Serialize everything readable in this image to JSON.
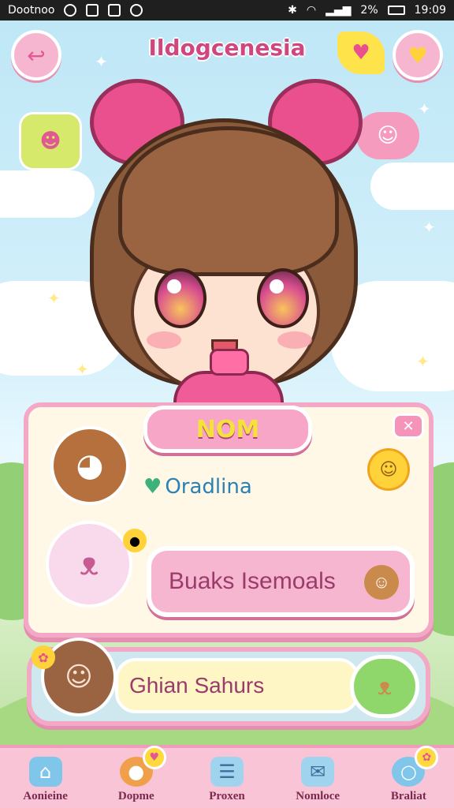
{
  "status_bar": {
    "carrier": "Dootnoo",
    "battery": "2%",
    "time": "19:09"
  },
  "header": {
    "title": "Ildogcenesia",
    "back_icon": "back-icon",
    "favorite_icon": "heart-icon"
  },
  "profile": {
    "name_banner": "NOM",
    "close_label": "✕"
  },
  "rows": [
    {
      "text": "Oradlina",
      "prefix_icon": "heart-icon"
    },
    {
      "button_label": "Buaks Isemoals"
    }
  ],
  "bottom_card": {
    "text": "Ghian Sahurs"
  },
  "nav": {
    "items": [
      {
        "label": "Aonieine",
        "icon": "home-icon"
      },
      {
        "label": "Dopme",
        "icon": "food-icon"
      },
      {
        "label": "Proxen",
        "icon": "notes-icon"
      },
      {
        "label": "Nomloce",
        "icon": "mail-icon"
      },
      {
        "label": "Braliat",
        "icon": "bubble-icon"
      }
    ]
  },
  "colors": {
    "accent": "#e9508d",
    "sky": "#bfe6f5",
    "nav_bg": "#f8c4d6"
  }
}
